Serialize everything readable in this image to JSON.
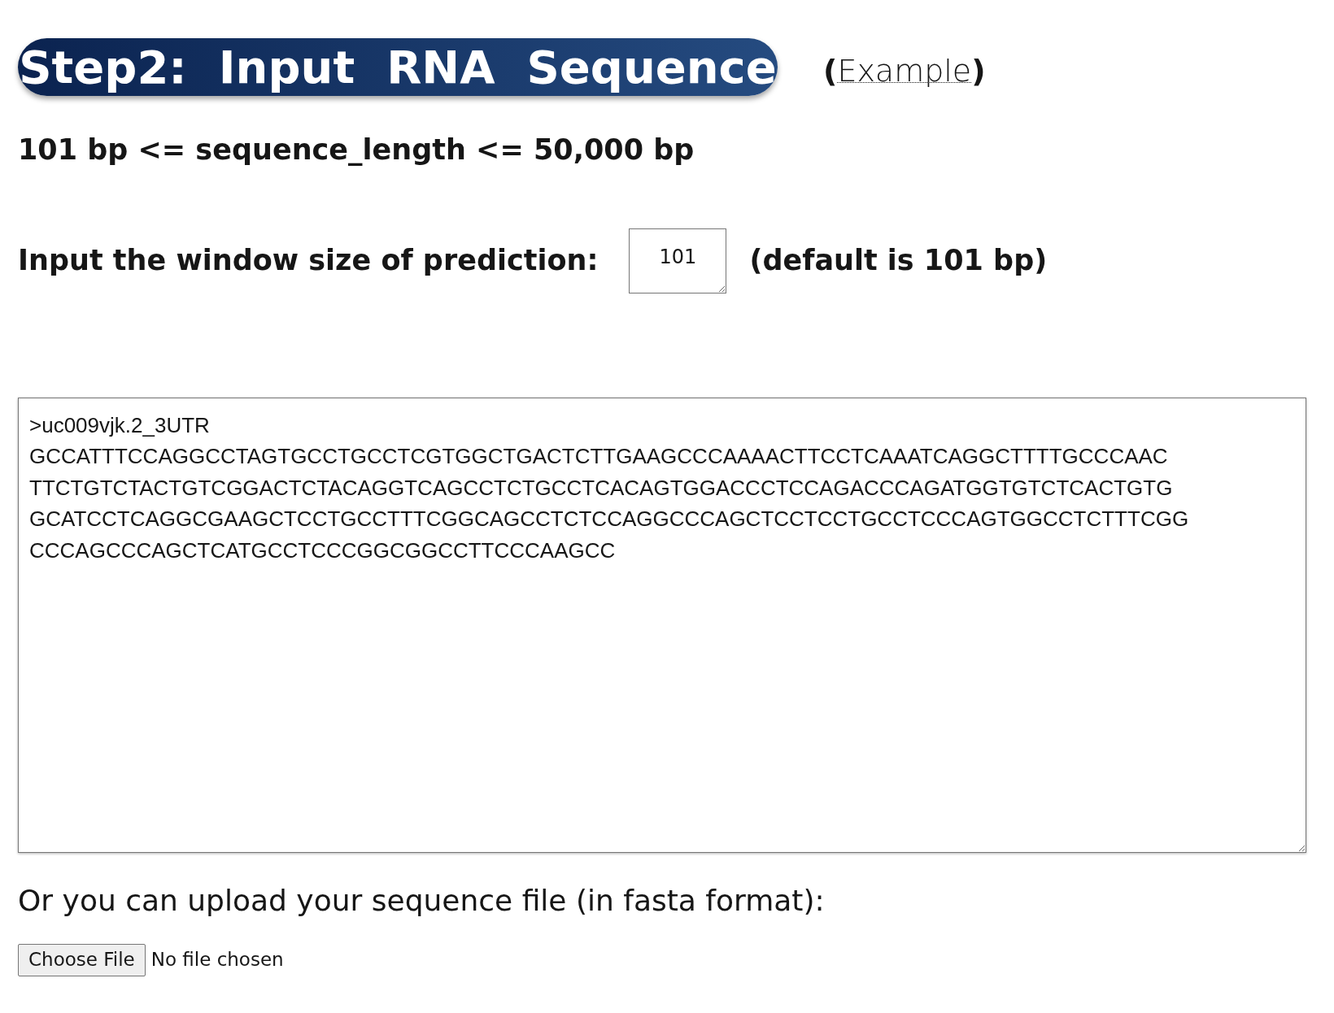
{
  "header": {
    "title": "Step2:  Input  RNA  Sequence",
    "link_open": "(",
    "link": "Example",
    "link_close": ")"
  },
  "length_rule": "101 bp <= sequence_length <= 50,000 bp",
  "window_size": {
    "label": "Input the window size of prediction:",
    "value": "101",
    "note": "(default is 101 bp)"
  },
  "sequence_box": {
    "lines": [
      ">uc009vjk.2_3UTR",
      "GCCATTTCCAGGCCTAGTGCCTGCCTCGTGGCTGACTCTTGAAGCCCAAAACTTCCTCAAATCAGGCTTTTGCCCAAC",
      "TTCTGTCTACTGTCGGACTCTACAGGTCAGCCTCTGCCTCACAGTGGACCCTCCAGACCCAGATGGTGTCTCACTGTG",
      "GCATCCTCAGGCGAAGCTCCTGCCTTTCGGCAGCCTCTCCAGGCCCAGCTCCTCCTGCCTCCCAGTGGCCTCTTTCGG",
      "CCCAGCCCAGCTCATGCCTCCCGGCGGCCTTCCCAAGCC"
    ]
  },
  "upload": {
    "label": "Or you can upload your sequence file (in fasta format):",
    "button": "Choose File",
    "status": "No file chosen"
  }
}
